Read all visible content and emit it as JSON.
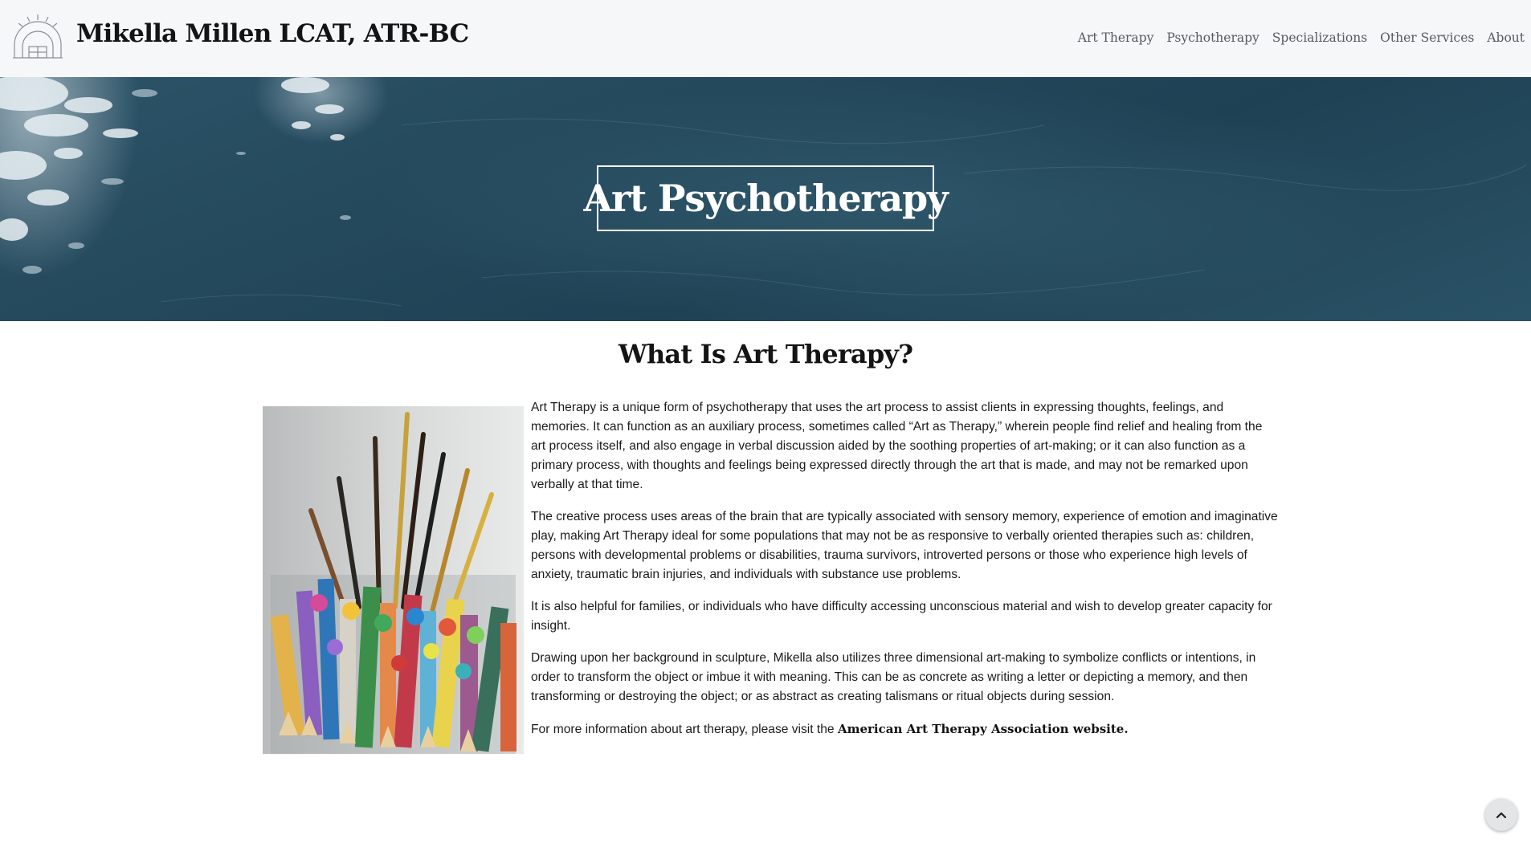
{
  "header": {
    "site_title": "Mikella Millen LCAT, ATR-BC",
    "logo_icon": "sunrise-arch-logo"
  },
  "nav": {
    "items": [
      {
        "label": "Art Therapy"
      },
      {
        "label": "Psychotherapy"
      },
      {
        "label": "Specializations"
      },
      {
        "label": "Other Services"
      },
      {
        "label": "About"
      }
    ]
  },
  "hero": {
    "title": "Art Psychotherapy"
  },
  "main": {
    "heading": "What Is Art Therapy?",
    "paragraphs": [
      "Art Therapy is a unique form of psychotherapy that uses the art process to assist clients in expressing thoughts, feelings, and memories. It can function as an auxiliary process, sometimes called “Art as Therapy,” wherein people find relief and healing from the art process itself, and also engage in verbal discussion aided by the soothing properties of art-making; or it can also function as a primary process, with thoughts and feelings being expressed directly through the art that is made, and may not be remarked upon verbally at that time.",
      "The creative process uses areas of the brain that are typically associated with sensory memory, experience of emotion and imaginative play, making Art Therapy ideal for some populations that may not be as responsive to verbally oriented therapies such as: children, persons with developmental problems or disabilities, trauma survivors, introverted persons or those who experience high levels of anxiety, traumatic brain injuries, and individuals with substance use problems.",
      "It is also helpful for families, or individuals who have difficulty accessing unconscious material and wish to develop greater capacity for insight.",
      "Drawing upon her background in sculpture, Mikella also utilizes three dimensional art-making to symbolize conflicts or intentions, in order to transform the object or imbue it with meaning. This can be as concrete as writing a letter or depicting a memory, and then transforming or destroying the object; or as abstract as creating talismans or ritual objects during session."
    ],
    "more_info": {
      "prefix": "For more information about art therapy, please visit the ",
      "link_text": "American Art Therapy Association website."
    }
  },
  "scroll_top": {
    "icon": "chevron-up-icon"
  }
}
